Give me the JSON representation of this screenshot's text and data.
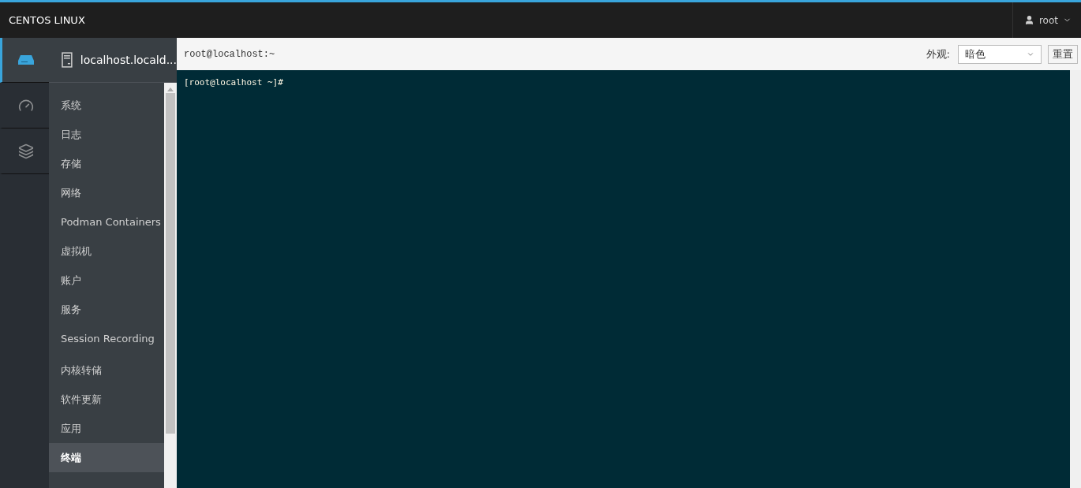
{
  "topbar": {
    "brand": "CENTOS LINUX",
    "user": "root"
  },
  "rail": [
    {
      "kind": "host",
      "selected": true
    },
    {
      "kind": "dashboard",
      "selected": false
    },
    {
      "kind": "apps",
      "selected": false
    }
  ],
  "host": {
    "name": "localhost.locald..."
  },
  "nav": [
    {
      "label": "系统",
      "selected": false,
      "group_start": false
    },
    {
      "label": "日志",
      "selected": false,
      "group_start": false
    },
    {
      "label": "存储",
      "selected": false,
      "group_start": false
    },
    {
      "label": "网络",
      "selected": false,
      "group_start": false
    },
    {
      "label": "Podman Containers",
      "selected": false,
      "group_start": false
    },
    {
      "label": "虚拟机",
      "selected": false,
      "group_start": false
    },
    {
      "label": "账户",
      "selected": false,
      "group_start": false
    },
    {
      "label": "服务",
      "selected": false,
      "group_start": false
    },
    {
      "label": "Session Recording",
      "selected": false,
      "group_start": false
    },
    {
      "label": "内核转储",
      "selected": false,
      "group_start": true
    },
    {
      "label": "软件更新",
      "selected": false,
      "group_start": false
    },
    {
      "label": "应用",
      "selected": false,
      "group_start": false
    },
    {
      "label": "终端",
      "selected": true,
      "group_start": false
    }
  ],
  "toolbar": {
    "title": "root@localhost:~",
    "appearance_label": "外观:",
    "appearance_value": "暗色",
    "reset": "重置"
  },
  "terminal": {
    "lines": [
      "[root@localhost ~]#"
    ]
  }
}
